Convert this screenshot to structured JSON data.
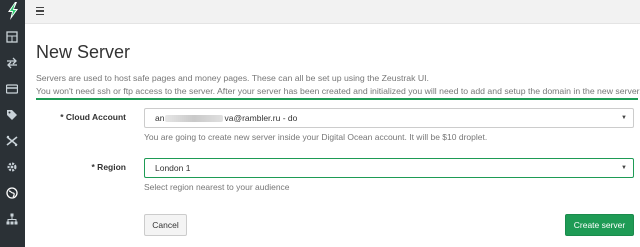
{
  "app": {
    "accent_color": "#1e9b55",
    "sidebar_color": "#2b3136"
  },
  "sidebar": {
    "logo_icon": "lightning-bolt-icon",
    "items": [
      {
        "icon": "calculator-icon"
      },
      {
        "icon": "swap-arrows-icon"
      },
      {
        "icon": "credit-card-icon"
      },
      {
        "icon": "tag-icon"
      },
      {
        "icon": "shuffle-icon"
      },
      {
        "icon": "cog-icon"
      },
      {
        "icon": "globe-icon"
      },
      {
        "icon": "sitemap-icon"
      }
    ]
  },
  "topbar": {
    "menu_icon": "hamburger-icon"
  },
  "page": {
    "title": "New Server",
    "description_line1": "Servers are used to host safe pages and money pages. These can all be set up using the Zeustrak UI.",
    "description_line2": "You won't need ssh or ftp access to the server. After your server has been created and initialized you will need to add and setup the domain in the new server."
  },
  "form": {
    "cloud_account": {
      "label": "* Cloud Account",
      "value_prefix": "an",
      "value_suffix": "va@rambler.ru - do",
      "help": "You are going to create new server inside your Digital Ocean account. It will be $10 droplet."
    },
    "region": {
      "label": "* Region",
      "value": "London 1",
      "help": "Select region nearest to your audience"
    },
    "cancel_label": "Cancel",
    "submit_label": "Create server"
  }
}
